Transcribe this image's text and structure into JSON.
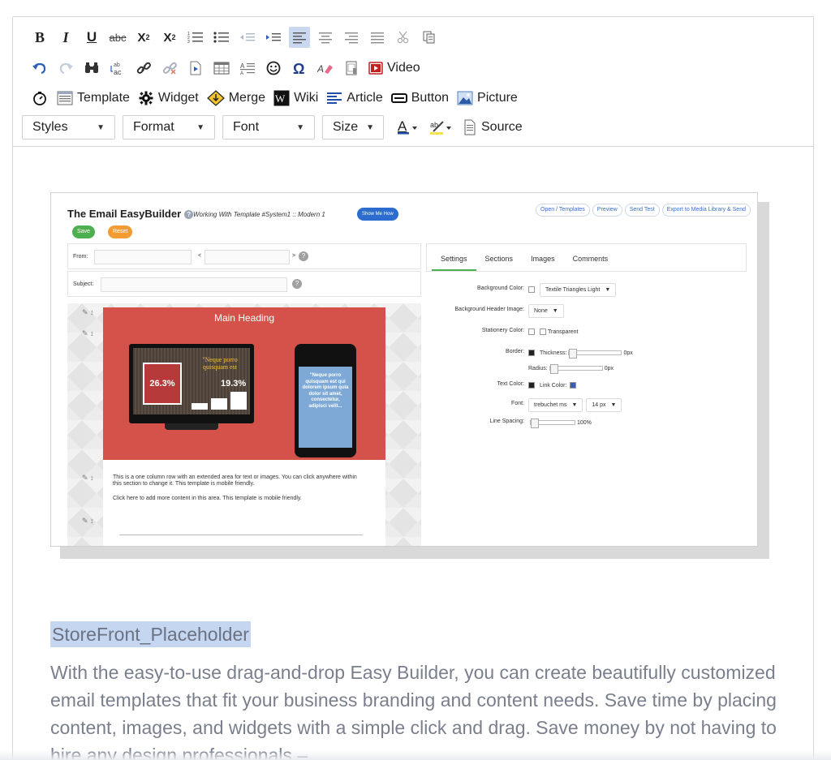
{
  "toolbar": {
    "row3": {
      "template": "Template",
      "widget": "Widget",
      "merge": "Merge",
      "wiki": "Wiki",
      "article": "Article",
      "button": "Button",
      "picture": "Picture"
    },
    "row2": {
      "video": "Video"
    },
    "row4": {
      "styles": "Styles",
      "format": "Format",
      "font": "Font",
      "size": "Size",
      "source": "Source"
    },
    "row1": {
      "bold": "B",
      "italic": "I",
      "underline": "U",
      "strike": "abc",
      "subscript": "X",
      "superscript": "X",
      "subscript_mark": "2",
      "superscript_mark": "2"
    }
  },
  "screenshot": {
    "title": "The Email EasyBuilder",
    "subtitle": "Working With Template #System1 :: Modern 1",
    "show_me_how": "Show Me How",
    "save": "Save",
    "reset": "Reset",
    "actions": [
      "Open / Templates",
      "Preview",
      "Send Test",
      "Export to Media Library & Send"
    ],
    "from_label": "From:",
    "lt": "<",
    "gt": ">",
    "subject_label": "Subject:",
    "email": {
      "heading": "Main Heading",
      "gift_pct": "26.3%",
      "quote": "\"Neque porro quisquam est",
      "pct2": "19.3%",
      "phone_text": "\"Neque porro quisquam est qui dolorem ipsum quia dolor sit amet, consectetur, adipisci velit...",
      "text1": "This is a one column row with an extended area for text or images. You can click anywhere within this section to change it. This template is mobile friendly.",
      "text2": "Click here to add more content in this area. This template is mobile friendly."
    },
    "tabs": [
      "Settings",
      "Sections",
      "Images",
      "Comments"
    ],
    "settings": {
      "bg_color_label": "Background Color:",
      "bg_color_value": "Textile Triangles Light",
      "bg_header_label": "Background Header Image:",
      "bg_header_value": "None",
      "stationery_label": "Stationery Color:",
      "stationery_value": "Transparent",
      "border_label": "Border:",
      "thickness_label": "Thickness:",
      "thickness_value": "0px",
      "radius_label": "Radius:",
      "radius_value": "0px",
      "text_color_label": "Text Color:",
      "link_color_label": "Link Color:",
      "font_label": "Font:",
      "font_value": "trebuchet ms",
      "font_size_value": "14 px",
      "line_spacing_label": "Line Spacing:",
      "line_spacing_value": "100%"
    }
  },
  "content": {
    "placeholder": "StoreFront_Placeholder",
    "paragraph": "With the easy-to-use drag-and-drop Easy Builder, you can create beautifully customized email templates that fit your business branding and content needs. Save time by placing content, images, and widgets with a simple click and drag. Save money by not having to hire any design professionals –"
  },
  "colors": {
    "accent_highlight": "#c5d6f1",
    "hero_red": "#d4524a",
    "save_green": "#4caf50",
    "reset_orange": "#f39c34",
    "show_blue": "#2d6ccf"
  }
}
